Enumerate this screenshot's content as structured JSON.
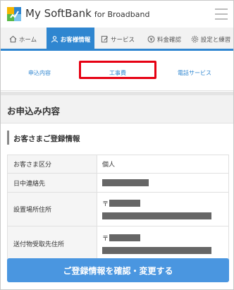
{
  "header": {
    "logo_text": "My SoftBank",
    "logo_sub": "for Broadband",
    "logo_icon": "softbank-cube-logo",
    "menu_icon": "hamburger-icon"
  },
  "nav": {
    "items": [
      {
        "label": "ホーム",
        "icon": "home-icon",
        "active": false
      },
      {
        "label": "お客様情報",
        "icon": "person-icon",
        "active": true
      },
      {
        "label": "サービス",
        "icon": "edit-icon",
        "active": false
      },
      {
        "label": "料金確認",
        "icon": "yen-coin-icon",
        "active": false
      },
      {
        "label": "設定と練習",
        "icon": "gear-icon",
        "active": false
      }
    ]
  },
  "subtabs": [
    {
      "label": "申込内容",
      "selected": false
    },
    {
      "label": "工事費",
      "selected": true
    },
    {
      "label": "電話サービス",
      "selected": false
    }
  ],
  "section": {
    "title": "お申込み内容",
    "subtitle": "お客さまご登録情報"
  },
  "table": {
    "rows": [
      {
        "label": "お客さま区分",
        "value": "個人"
      },
      {
        "label": "日中連絡先",
        "value": ""
      },
      {
        "label": "設置場所住所",
        "postal_mark": "〒"
      },
      {
        "label": "送付物受取先住所",
        "postal_mark": "〒"
      }
    ]
  },
  "cta": {
    "label": "ご登録情報を確認・変更する"
  },
  "colors": {
    "accent": "#2f86d0",
    "button": "#4a96e0",
    "highlight": "#e60012",
    "redaction": "#666666"
  }
}
